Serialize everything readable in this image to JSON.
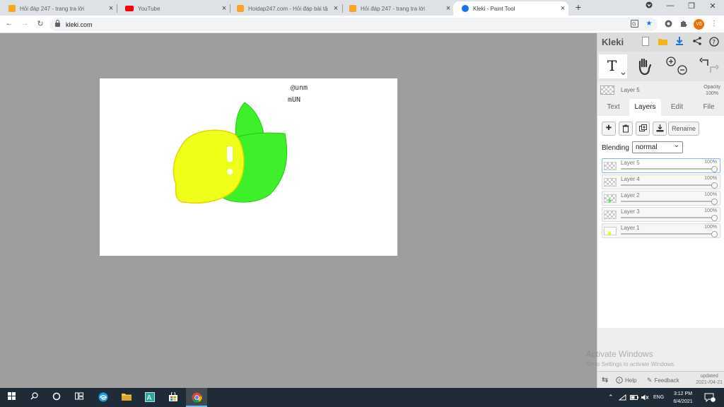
{
  "browser": {
    "tabs": [
      {
        "title": "Hỏi đáp 247 - trang tra lời",
        "favicon_color": "#f5a623"
      },
      {
        "title": "YouTube",
        "favicon_color": "#ff0000"
      },
      {
        "title": "Hoidap247.com - Hỏi đáp bài tậ",
        "favicon_color": "#f5a623"
      },
      {
        "title": "Hỏi đáp 247 - trang tra lời",
        "favicon_color": "#f5a623"
      },
      {
        "title": "Kleki - Paint Tool",
        "favicon_color": "#1a73e8"
      }
    ],
    "tab_close": "×",
    "new_tab": "+",
    "url": "kleki.com",
    "avatar_text": "Vô",
    "window_controls": {
      "minimize": "—",
      "restore": "❐",
      "close": "✕"
    }
  },
  "canvas": {
    "text_top": "@unm",
    "text_bottom": "mUN",
    "colors": {
      "lemon": "#f0ff1a",
      "lemon_outline": "#e6d400",
      "leaf": "#3ef029",
      "leaf_outline": "#2ac41a"
    }
  },
  "kleki": {
    "logo": "Kleki",
    "layer_info": {
      "name": "Layer 5",
      "opacity_label": "Opacity",
      "opacity_value": "100%"
    },
    "tabs": [
      "Text",
      "Layers",
      "Edit",
      "File"
    ],
    "active_tab": "Layers",
    "rename_label": "Rename",
    "blending_label": "Blending",
    "blending_value": "normal",
    "layers": [
      {
        "name": "Layer 5",
        "opacity": "100%",
        "active": true
      },
      {
        "name": "Layer 4",
        "opacity": "100%",
        "active": false
      },
      {
        "name": "Layer 2",
        "opacity": "100%",
        "active": false
      },
      {
        "name": "Layer 3",
        "opacity": "100%",
        "active": false
      },
      {
        "name": "Layer 1",
        "opacity": "100%",
        "active": false
      }
    ],
    "footer": {
      "help": "Help",
      "feedback": "Feedback",
      "updated_label": "updated",
      "updated_date": "2021-/04-21"
    }
  },
  "watermark": {
    "title": "Activate Windows",
    "subtitle": "Go to Settings to activate Windows."
  },
  "taskbar": {
    "language": "ENG",
    "time": "3:12 PM",
    "date": "6/4/2021",
    "notification_count": "1"
  }
}
